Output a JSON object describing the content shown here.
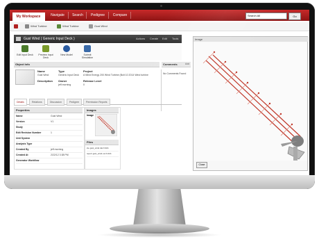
{
  "nav": {
    "tabs": [
      "My Workspace",
      "Navigate",
      "Search",
      "Pedigree",
      "Compare"
    ],
    "search_placeholder": "Search All",
    "search_button": "Go"
  },
  "toolbar": {
    "items": [
      "Wind Turbine",
      "Wind Turbine",
      "Gust Wind"
    ]
  },
  "object": {
    "title": "Gust Wind ( Generic Input Deck )",
    "header_actions": [
      "Actions",
      "Create",
      "Edit",
      "Tools"
    ],
    "actions": [
      {
        "label": "Edit Input Deck",
        "color": "#4a7a2a"
      },
      {
        "label": "Preview Input Deck",
        "color": "#7a9a2a"
      },
      {
        "label": "New Model",
        "color": "#2a5aa0"
      },
      {
        "label": "Submit Simulation",
        "color": "#3a6aa8"
      }
    ]
  },
  "object_info": {
    "heading": "Object Info",
    "name_label": "Name",
    "name_value": "Gust Wind",
    "type_label": "Type",
    "type_value": "Generic Input Deck",
    "project_label": "Project",
    "project_value": "A Wind Energy 200 Wind Turbine (Bolt 10 2014 Wind turbine",
    "description_label": "Description",
    "owner_label": "Owner",
    "owner_value": "jeff.morning",
    "release_label": "Release Level",
    "release_value": "0"
  },
  "comments": {
    "heading": "Comments",
    "add": "Add",
    "empty": "No Comments Found"
  },
  "subtabs": [
    "Details",
    "Relations",
    "Discussion",
    "Pedigree",
    "Permission Reports"
  ],
  "properties": {
    "heading": "Properties",
    "rows": [
      {
        "key": "Name",
        "value": "Gust Wind"
      },
      {
        "key": "Version",
        "value": "V1"
      },
      {
        "key": "Study",
        "value": ""
      },
      {
        "key": "Edit Revision Number",
        "value": "1"
      },
      {
        "key": "Unit System",
        "value": ""
      },
      {
        "key": "Analysis Type",
        "value": ""
      },
      {
        "key": "Created By",
        "value": "jeff.morning"
      },
      {
        "key": "Created At",
        "value": "2/22/12 3:38 PM"
      },
      {
        "key": "Generator Workflow",
        "value": ""
      }
    ]
  },
  "images": {
    "heading": "Images",
    "image_label": "Image",
    "files_heading": "Files",
    "files": [
      {
        "name": "ice",
        "file": "gust_wind.dat",
        "size": "9.3kb"
      },
      {
        "name": "report",
        "file": "gust_wind.out",
        "size": "9.2kb"
      }
    ]
  },
  "viewer": {
    "heading": "Image",
    "close": "Close"
  }
}
